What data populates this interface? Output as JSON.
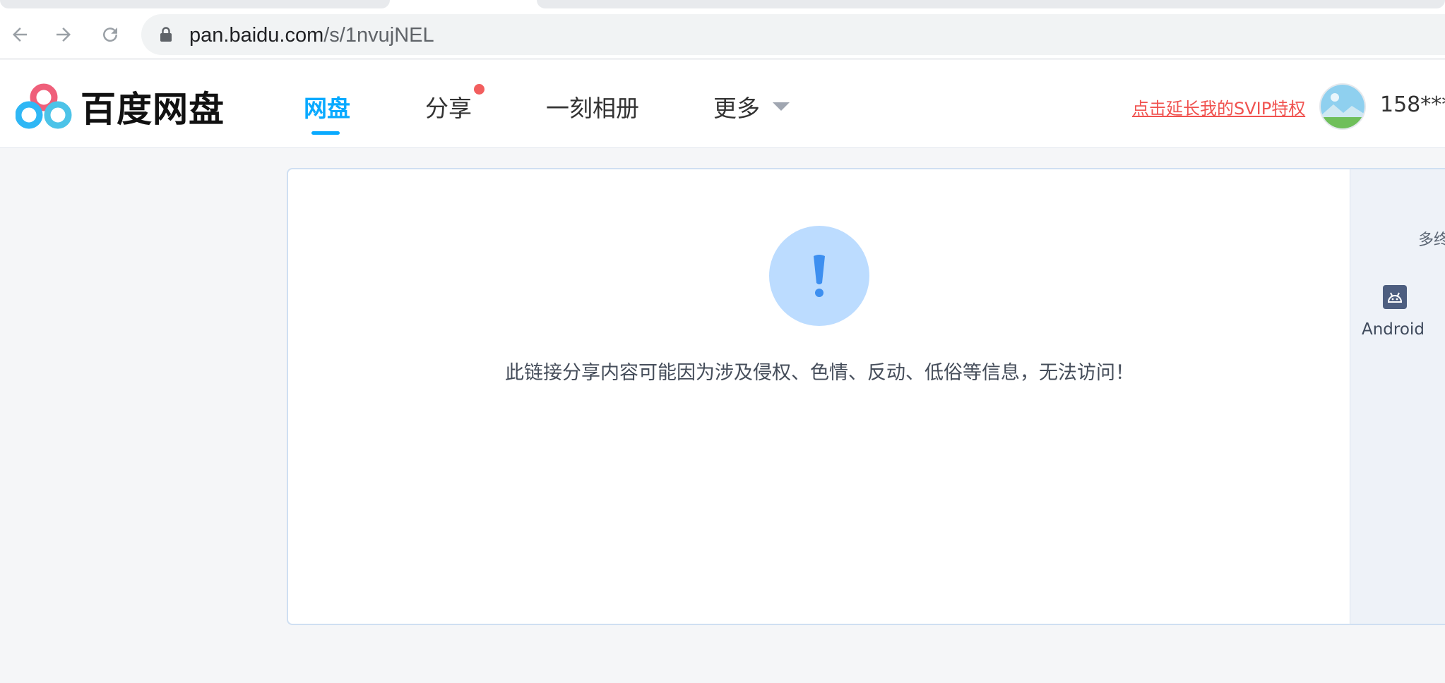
{
  "browser": {
    "url_host": "pan.baidu.com",
    "url_path": "/s/1nvujNEL"
  },
  "header": {
    "logo_text": "百度网盘",
    "nav": [
      "网盘",
      "分享",
      "一刻相册",
      "更多"
    ],
    "svip_link": "点击延长我的SVIP特权",
    "username": "158***"
  },
  "main": {
    "message": "此链接分享内容可能因为涉及侵权、色情、反动、低俗等信息，无法访问！"
  },
  "side": {
    "top_text": "多终",
    "android_label": "Android"
  },
  "colors": {
    "accent": "#09aaff",
    "svip": "#f0524f",
    "alert_bg": "#bcdcff",
    "alert_fg": "#3d8ff0"
  },
  "icons": [
    "back-arrow-icon",
    "forward-arrow-icon",
    "reload-icon",
    "lock-icon",
    "baidu-netdisk-logo-icon",
    "dropdown-caret-icon",
    "exclamation-icon",
    "android-icon"
  ]
}
